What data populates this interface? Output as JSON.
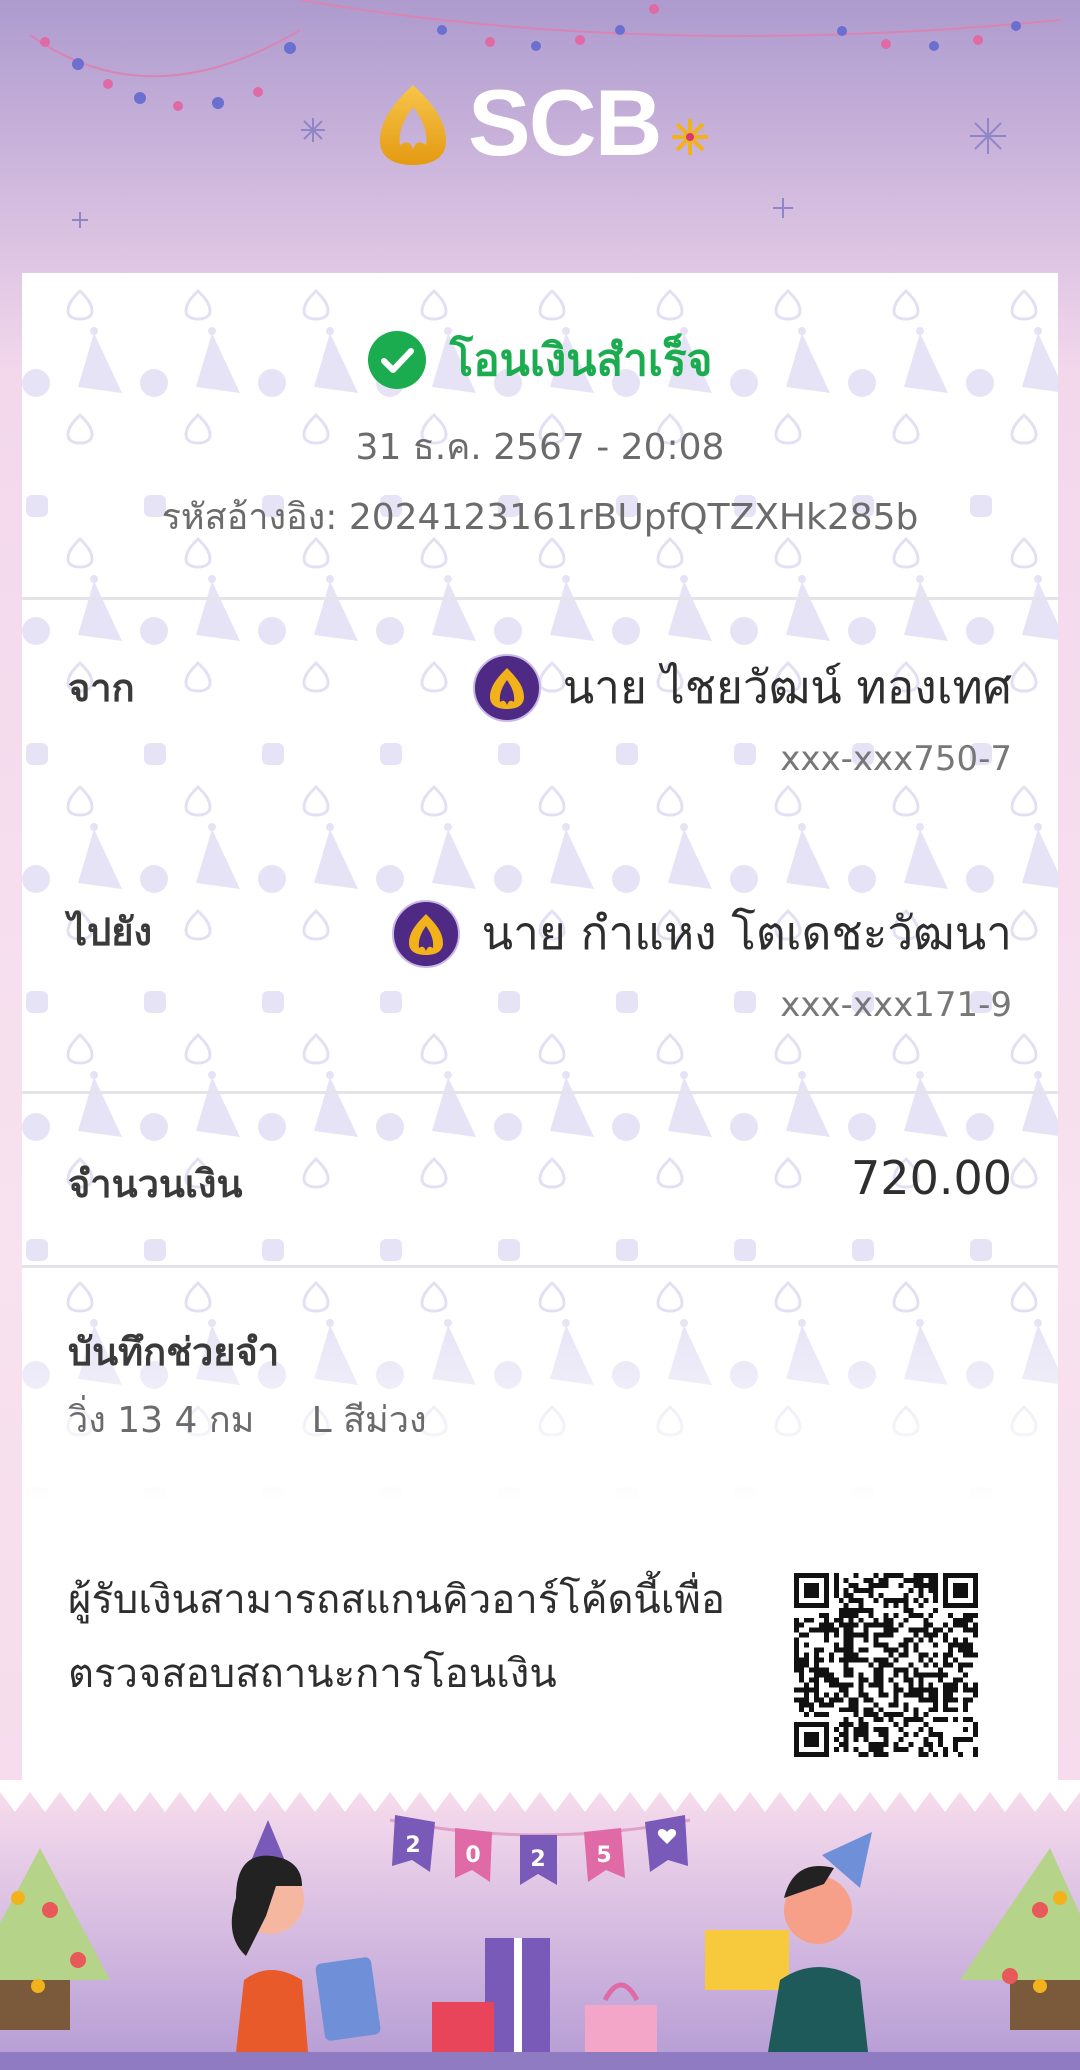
{
  "brand": {
    "name": "SCB"
  },
  "status": {
    "title": "โอนเงินสำเร็จ",
    "icon": "check-circle-icon",
    "color": "#1bac50"
  },
  "datetime": "31 ธ.ค. 2567 - 20:08",
  "reference": {
    "label": "รหัสอ้างอิง:",
    "value": "2024123161rBUpfQTZXHk285b"
  },
  "from": {
    "label": "จาก",
    "name": "นาย ไชยวัฒน์ ทองเทศ",
    "account": "xxx-xxx750-7",
    "icon": "scb-logo-icon"
  },
  "to": {
    "label": "ไปยัง",
    "name": "นาย กำแหง โตเดชะวัฒนา",
    "account": "xxx-xxx171-9",
    "icon": "scb-logo-icon"
  },
  "amount": {
    "label": "จำนวนเงิน",
    "value": "720.00"
  },
  "memo": {
    "label": "บันทึกช่วยจำ",
    "value": "วิ่ง 13 4 กม     L สีม่วง"
  },
  "qr": {
    "text": "ผู้รับเงินสามารถสแกนคิวอาร์โค้ดนี้เพื่อตรวจสอบสถานะการโอนเงิน",
    "icon": "qr-code-icon"
  },
  "banner": {
    "letters": [
      "2",
      "0",
      "2",
      "5"
    ]
  },
  "colors": {
    "brand_purple": "#4e2a84",
    "brand_gold": "#f2b21b",
    "success_green": "#1bac50"
  }
}
